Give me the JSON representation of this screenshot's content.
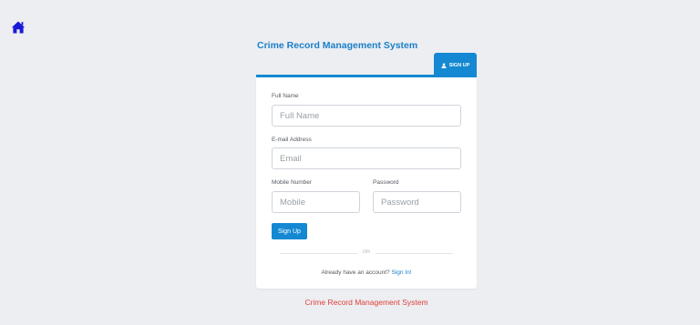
{
  "header": {
    "home_icon": "home-icon",
    "app_title": "Crime Record Management System"
  },
  "tab": {
    "icon": "user-icon",
    "label": "SIGN UP"
  },
  "form": {
    "full_name": {
      "label": "Full Name",
      "placeholder": "Full Name",
      "value": ""
    },
    "email": {
      "label": "E-mail Address",
      "placeholder": "Email",
      "value": ""
    },
    "mobile": {
      "label": "Mobile Number",
      "placeholder": "Mobile",
      "value": ""
    },
    "password": {
      "label": "Password",
      "placeholder": "Password",
      "value": ""
    },
    "submit_label": "Sign Up",
    "divider_text": "OR",
    "account_prompt": "Already have an account?",
    "signin_link": "Sign In!"
  },
  "footer": {
    "text": "Crime Record Management System"
  },
  "colors": {
    "accent": "#1488d2",
    "title": "#1b7fc7",
    "footer_text": "#e0403a",
    "background": "#eceef2"
  }
}
